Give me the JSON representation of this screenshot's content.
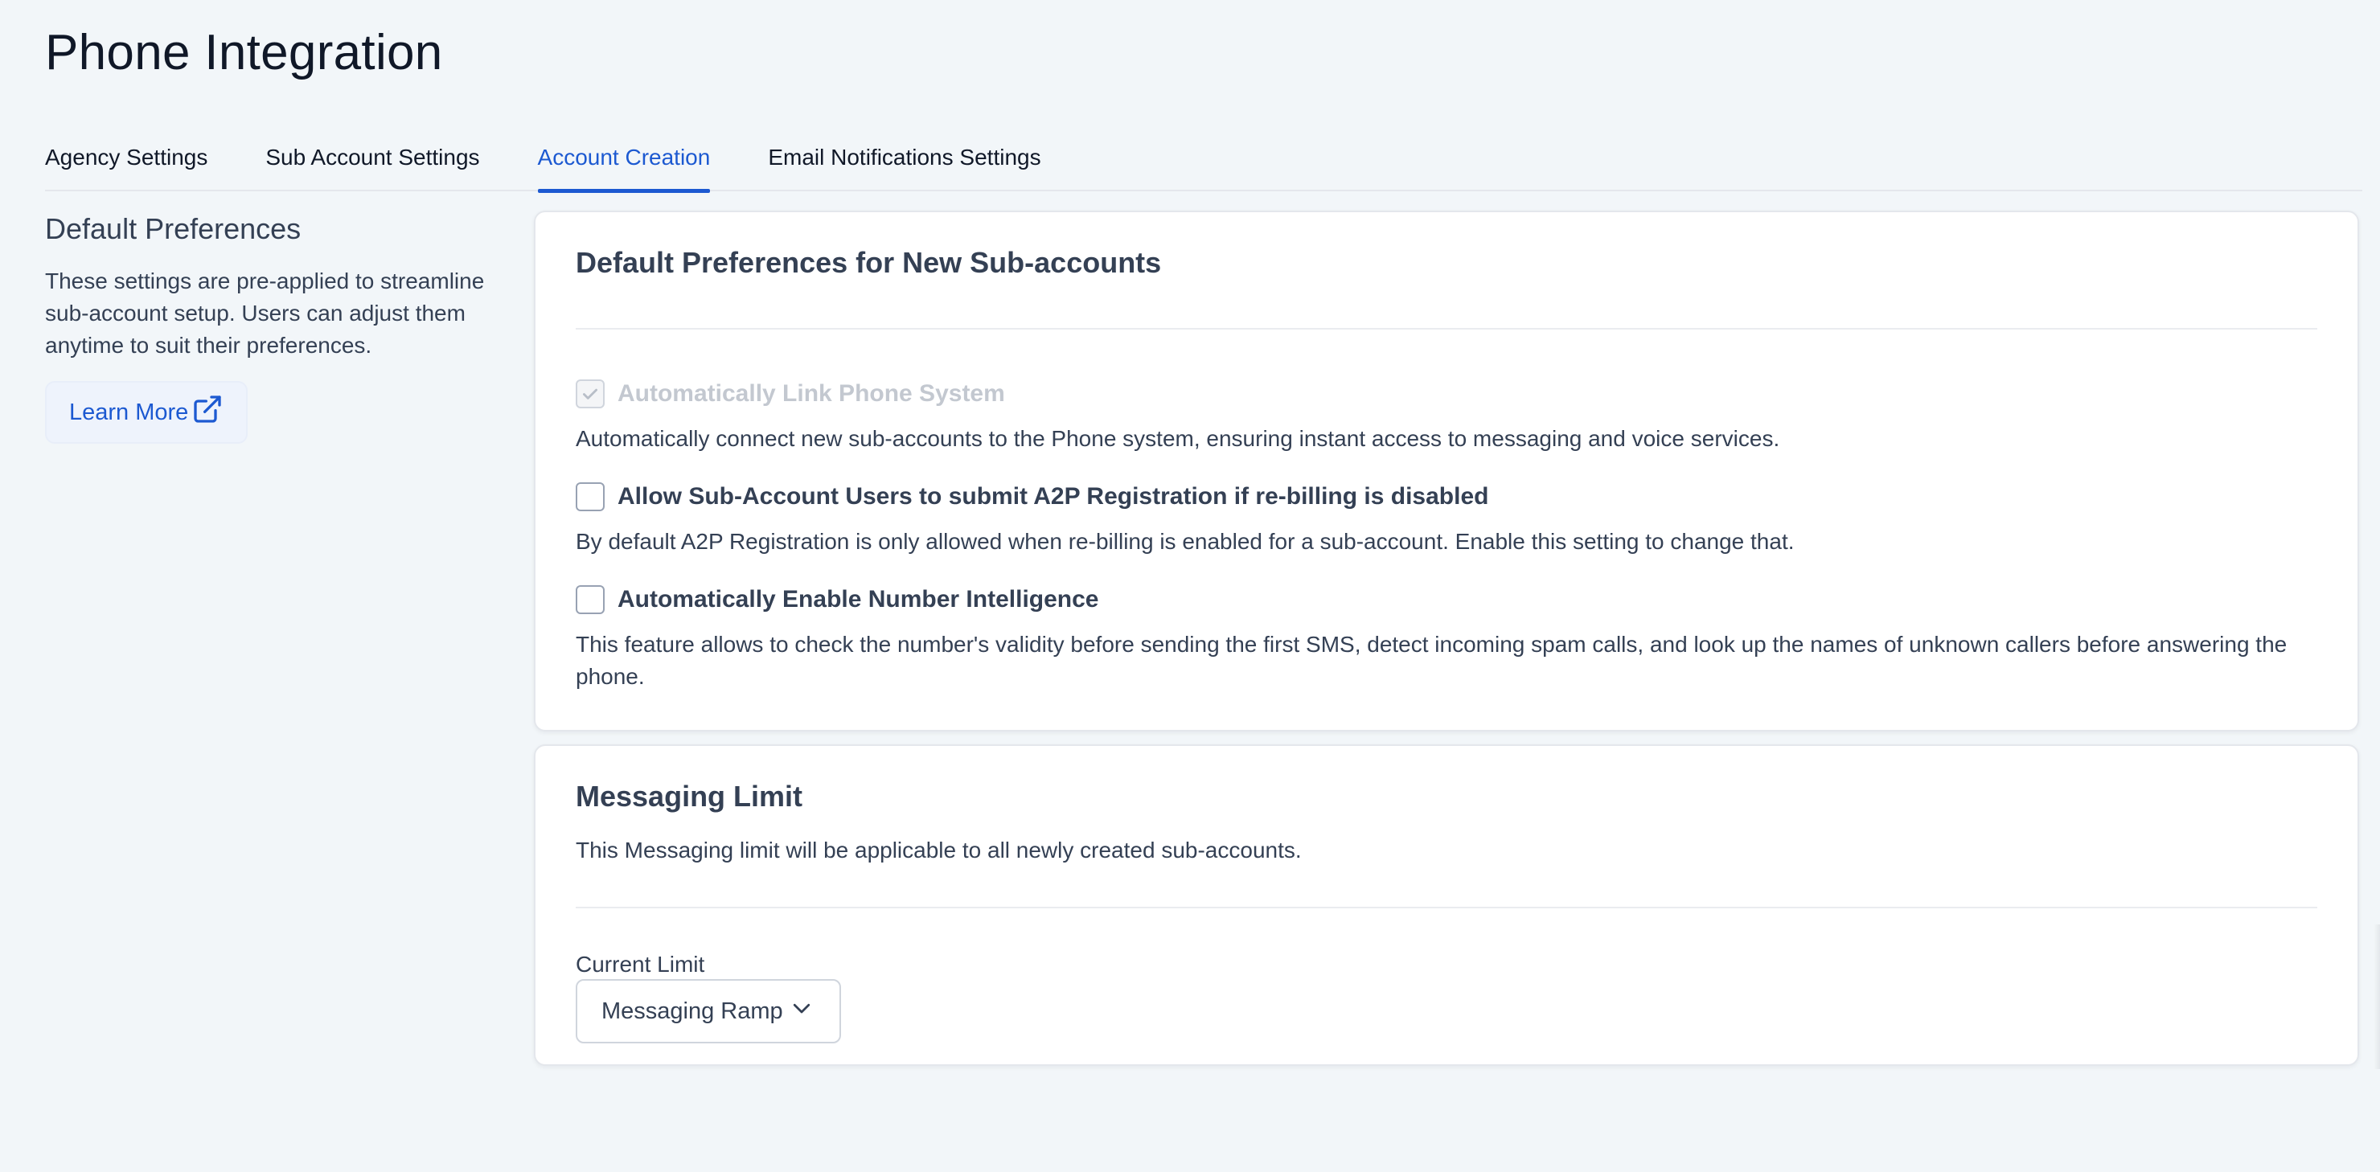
{
  "page": {
    "title": "Phone Integration"
  },
  "tabs": [
    {
      "label": "Agency Settings",
      "active": false
    },
    {
      "label": "Sub Account Settings",
      "active": false
    },
    {
      "label": "Account Creation",
      "active": true
    },
    {
      "label": "Email Notifications Settings",
      "active": false
    }
  ],
  "sidebar": {
    "title": "Default Preferences",
    "description": "These settings are pre-applied to streamline sub-account setup. Users can adjust them anytime to suit their preferences.",
    "learn_more": "Learn More"
  },
  "preferences": {
    "title": "Default Preferences for New Sub-accounts",
    "options": [
      {
        "label": "Automatically Link Phone System",
        "description": "Automatically connect new sub-accounts to the Phone system, ensuring instant access to messaging and voice services.",
        "checked": true,
        "disabled": true
      },
      {
        "label": "Allow Sub-Account Users to submit A2P Registration if re-billing is disabled",
        "description": "By default A2P Registration is only allowed when re-billing is enabled for a sub-account. Enable this setting to change that.",
        "checked": false,
        "disabled": false
      },
      {
        "label": "Automatically Enable Number Intelligence",
        "description": "This feature allows to check the number's validity before sending the first SMS, detect incoming spam calls, and look up the names of unknown callers before answering the phone.",
        "checked": false,
        "disabled": false
      }
    ]
  },
  "messaging_limit": {
    "title": "Messaging Limit",
    "description": "This Messaging limit will be applicable to all newly created sub-accounts.",
    "current_limit_label": "Current Limit",
    "selected_value": "Messaging Ramp"
  },
  "colors": {
    "accent": "#1c59d1",
    "background": "#f2f6f9",
    "text": "#344054"
  },
  "icons": {
    "learn_more": "external-link-icon",
    "select": "chevron-down-icon",
    "checked": "check-icon"
  }
}
